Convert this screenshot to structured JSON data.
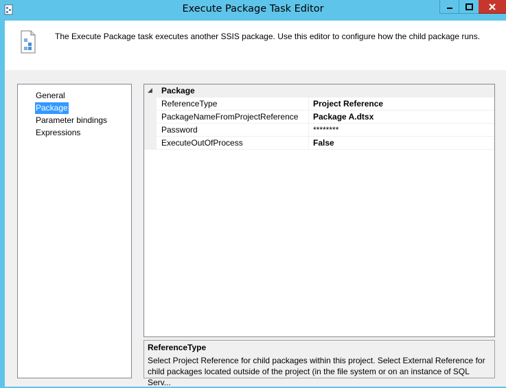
{
  "window": {
    "title": "Execute Package Task Editor"
  },
  "header": {
    "description": "The Execute Package task executes another SSIS package. Use this editor to configure how the child package runs."
  },
  "nav": {
    "items": [
      {
        "label": "General",
        "selected": false
      },
      {
        "label": "Package",
        "selected": true
      },
      {
        "label": "Parameter bindings",
        "selected": false
      },
      {
        "label": "Expressions",
        "selected": false
      }
    ]
  },
  "grid": {
    "category": "Package",
    "rows": [
      {
        "name": "ReferenceType",
        "value": "Project Reference",
        "bold": true
      },
      {
        "name": "PackageNameFromProjectReference",
        "value": "Package A.dtsx",
        "bold": true
      },
      {
        "name": "Password",
        "value": "********",
        "bold": false
      },
      {
        "name": "ExecuteOutOfProcess",
        "value": "False",
        "bold": true
      }
    ]
  },
  "help": {
    "title": "ReferenceType",
    "text": "Select Project Reference for child packages within this project. Select External Reference for child packages located outside of the project (in the file system or on an instance of SQL Serv..."
  },
  "colors": {
    "titlebar": "#5fc4ea",
    "close_button": "#c7362d",
    "selection": "#3399ff"
  }
}
